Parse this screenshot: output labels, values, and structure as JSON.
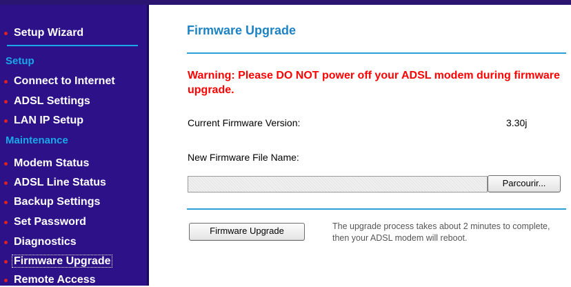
{
  "sidebar": {
    "setup_wizard": "Setup Wizard",
    "sections": {
      "setup": "Setup",
      "maintenance": "Maintenance"
    },
    "setup_items": [
      "Connect to Internet",
      "ADSL Settings",
      "LAN IP Setup"
    ],
    "maintenance_items": [
      "Modem Status",
      "ADSL Line Status",
      "Backup Settings",
      "Set Password",
      "Diagnostics",
      "Firmware Upgrade",
      "Remote Access"
    ],
    "active_item": "Firmware Upgrade"
  },
  "main": {
    "title": "Firmware Upgrade",
    "warning": "Warning: Please DO NOT power off your ADSL modem during firmware upgrade.",
    "current_version_label": "Current Firmware Version:",
    "current_version_value": "3.30j",
    "new_file_label": "New Firmware File Name:",
    "file_input_value": "",
    "browse_button": "Parcourir...",
    "upgrade_button": "Firmware Upgrade",
    "upgrade_note": "The upgrade process takes about 2 minutes to complete, then your ADSL modem will reboot."
  },
  "colors": {
    "sidebar_bg": "#2d1189",
    "section_heading": "#19a8e8",
    "title": "#1e83c4",
    "warning": "#ff0000",
    "bullet": "#e02020"
  }
}
